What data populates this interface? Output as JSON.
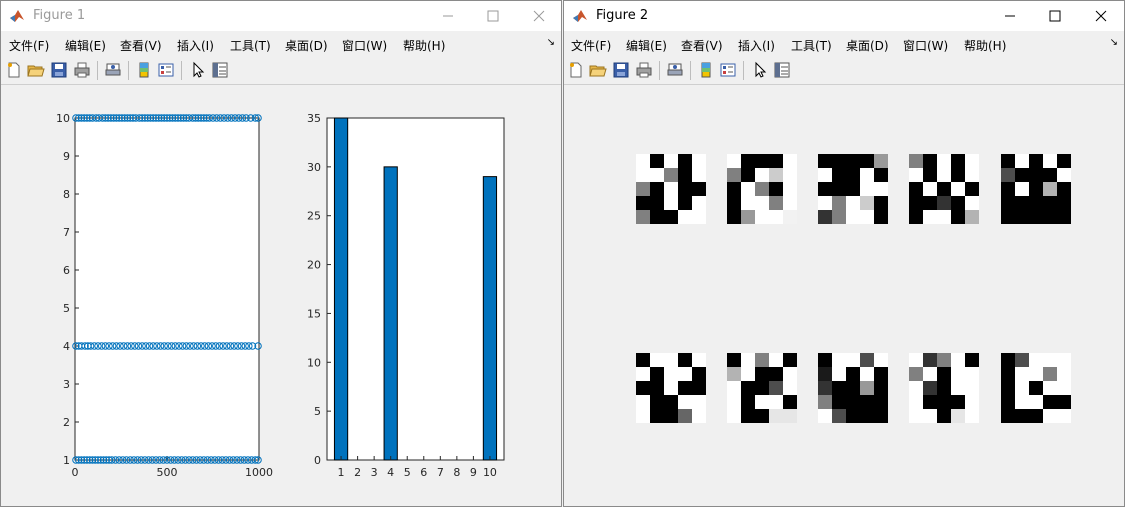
{
  "figure1": {
    "title": "Figure 1",
    "menu": [
      "文件(F)",
      "编辑(E)",
      "查看(V)",
      "插入(I)",
      "工具(T)",
      "桌面(D)",
      "窗口(W)",
      "帮助(H)"
    ],
    "toolbar_icons": [
      "new-file-icon",
      "open-folder-icon",
      "save-icon",
      "print-icon",
      "print-preview-icon",
      "colorbar-icon",
      "legend-icon",
      "pointer-icon",
      "property-inspector-icon"
    ]
  },
  "figure2": {
    "title": "Figure 2",
    "menu": [
      "文件(F)",
      "编辑(E)",
      "查看(V)",
      "插入(I)",
      "工具(T)",
      "桌面(D)",
      "窗口(W)",
      "帮助(H)"
    ],
    "toolbar_icons": [
      "new-file-icon",
      "open-folder-icon",
      "save-icon",
      "print-icon",
      "print-preview-icon",
      "colorbar-icon",
      "legend-icon",
      "pointer-icon",
      "property-inspector-icon"
    ],
    "images": [
      [
        [
          1,
          0,
          1,
          0,
          1
        ],
        [
          1,
          1,
          0.5,
          0,
          1
        ],
        [
          0.5,
          0,
          1,
          0,
          0
        ],
        [
          0,
          0,
          1,
          0,
          1
        ],
        [
          0.5,
          0,
          0,
          1,
          1
        ]
      ],
      [
        [
          1,
          0,
          0,
          0,
          1
        ],
        [
          0.5,
          0,
          1,
          0.8,
          1
        ],
        [
          0,
          1,
          0.5,
          0,
          1
        ],
        [
          0,
          1,
          1,
          0.5,
          1
        ],
        [
          0,
          0.6,
          1,
          1,
          0.95
        ]
      ],
      [
        [
          0,
          0,
          0,
          0,
          0.6
        ],
        [
          1,
          0,
          0,
          1,
          0
        ],
        [
          0,
          0,
          0,
          1,
          1
        ],
        [
          1,
          0.5,
          1,
          0.8,
          0
        ],
        [
          0.2,
          0.5,
          1,
          1,
          0
        ]
      ],
      [
        [
          0.5,
          0,
          1,
          0,
          1
        ],
        [
          1,
          0,
          1,
          0,
          1
        ],
        [
          0,
          1,
          0,
          1,
          0
        ],
        [
          0,
          0,
          0.2,
          0,
          1
        ],
        [
          0,
          1,
          1,
          0,
          0.7
        ]
      ],
      [
        [
          0,
          1,
          0,
          1,
          0
        ],
        [
          0.3,
          0,
          0,
          0,
          1
        ],
        [
          0,
          1,
          0,
          0.7,
          0
        ],
        [
          0,
          0,
          0,
          0,
          0
        ],
        [
          0,
          0,
          0,
          0,
          0
        ]
      ],
      [
        [
          0,
          1,
          1,
          0,
          1
        ],
        [
          1,
          0,
          1,
          1,
          0
        ],
        [
          0,
          0,
          1,
          0,
          0
        ],
        [
          1,
          0,
          0,
          1,
          1
        ],
        [
          1,
          0,
          0,
          0.4,
          1
        ]
      ],
      [
        [
          0,
          1,
          0.5,
          1,
          0
        ],
        [
          0.7,
          1,
          0,
          0,
          1
        ],
        [
          1,
          0,
          0,
          0.3,
          1
        ],
        [
          1,
          0,
          1,
          1,
          0
        ],
        [
          1,
          0,
          0,
          0.9,
          0.9
        ]
      ],
      [
        [
          0,
          1,
          1,
          0.3,
          1
        ],
        [
          0.1,
          1,
          0,
          1,
          0
        ],
        [
          0.2,
          0,
          0,
          0.6,
          0
        ],
        [
          0.5,
          0,
          0,
          0,
          0
        ],
        [
          1,
          0.3,
          0,
          0,
          0
        ]
      ],
      [
        [
          1,
          0.2,
          0.5,
          1,
          0
        ],
        [
          0.5,
          1,
          0,
          1,
          1
        ],
        [
          1,
          0.2,
          0,
          1,
          1
        ],
        [
          1,
          0,
          0,
          0,
          1
        ],
        [
          1,
          1,
          0,
          0.9,
          1
        ]
      ],
      [
        [
          0,
          0.3,
          1,
          1,
          1
        ],
        [
          0,
          1,
          1,
          0.5,
          1
        ],
        [
          0,
          1,
          0,
          1,
          1
        ],
        [
          0,
          1,
          1,
          0,
          0
        ],
        [
          0,
          0,
          0,
          1,
          1
        ]
      ]
    ]
  },
  "chart_data": [
    {
      "type": "scatter",
      "title": "",
      "xlabel": "",
      "ylabel": "",
      "xlim": [
        0,
        1000
      ],
      "ylim": [
        1,
        10
      ],
      "xticks": [
        "0",
        "500",
        "1000"
      ],
      "yticks": [
        "1",
        "2",
        "3",
        "4",
        "5",
        "6",
        "7",
        "8",
        "9",
        "10"
      ],
      "marker": "open-circle",
      "color": "#0072bd",
      "series": [
        {
          "y": 10,
          "x": [
            5,
            20,
            35,
            50,
            65,
            80,
            95,
            115,
            130,
            150,
            165,
            180,
            195,
            210,
            225,
            240,
            255,
            270,
            285,
            300,
            315,
            330,
            350,
            365,
            380,
            395,
            410,
            425,
            440,
            455,
            470,
            485,
            500,
            515,
            530,
            545,
            560,
            575,
            590,
            605,
            620,
            640,
            655,
            670,
            685,
            700,
            715,
            730,
            750,
            770,
            790,
            810,
            830,
            850,
            870,
            890,
            910,
            930,
            955,
            980,
            995
          ]
        },
        {
          "y": 4,
          "x": [
            5,
            20,
            35,
            55,
            70,
            85,
            105,
            125,
            145,
            165,
            185,
            205,
            225,
            245,
            265,
            285,
            305,
            325,
            345,
            365,
            385,
            405,
            425,
            445,
            465,
            485,
            505,
            525,
            545,
            565,
            585,
            605,
            625,
            645,
            665,
            685,
            705,
            725,
            745,
            765,
            785,
            805,
            825,
            845,
            865,
            885,
            905,
            925,
            945,
            965,
            995
          ]
        },
        {
          "y": 1,
          "x": [
            5,
            20,
            35,
            50,
            65,
            80,
            95,
            110,
            125,
            140,
            155,
            170,
            185,
            200,
            220,
            240,
            260,
            280,
            300,
            320,
            340,
            360,
            380,
            400,
            420,
            440,
            460,
            480,
            500,
            520,
            540,
            560,
            580,
            600,
            620,
            640,
            660,
            680,
            700,
            720,
            740,
            760,
            780,
            800,
            820,
            840,
            860,
            880,
            900,
            920,
            940,
            960,
            980,
            995
          ]
        }
      ]
    },
    {
      "type": "bar",
      "title": "",
      "xlabel": "",
      "ylabel": "",
      "categories": [
        "1",
        "2",
        "3",
        "4",
        "5",
        "6",
        "7",
        "8",
        "9",
        "10"
      ],
      "values": [
        35,
        0,
        0,
        30,
        0,
        0,
        0,
        0,
        0,
        29
      ],
      "ylim": [
        0,
        35
      ],
      "yticks": [
        "0",
        "5",
        "10",
        "15",
        "20",
        "25",
        "30",
        "35"
      ],
      "color": "#0072bd"
    }
  ]
}
